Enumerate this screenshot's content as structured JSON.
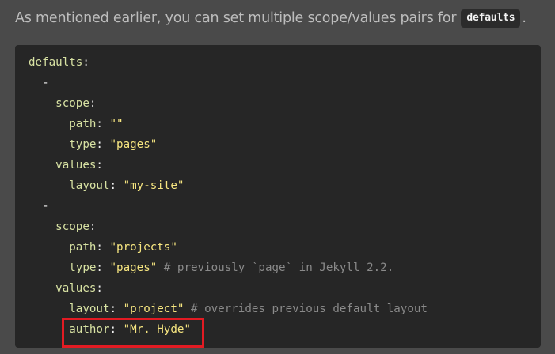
{
  "intro": {
    "text": "As mentioned earlier, you can set multiple scope/values pairs for",
    "code": "defaults",
    "trail": "."
  },
  "code_lines": [
    {
      "indent": "",
      "parts": [
        {
          "t": "defaults",
          "c": "k"
        },
        {
          "t": ":",
          "c": "p"
        }
      ]
    },
    {
      "indent": "  ",
      "parts": [
        {
          "t": "-",
          "c": "p"
        }
      ]
    },
    {
      "indent": "    ",
      "parts": [
        {
          "t": "scope",
          "c": "k"
        },
        {
          "t": ":",
          "c": "p"
        }
      ]
    },
    {
      "indent": "      ",
      "parts": [
        {
          "t": "path",
          "c": "k"
        },
        {
          "t": ": ",
          "c": "p"
        },
        {
          "t": "\"\"",
          "c": "s"
        }
      ]
    },
    {
      "indent": "      ",
      "parts": [
        {
          "t": "type",
          "c": "k"
        },
        {
          "t": ": ",
          "c": "p"
        },
        {
          "t": "\"pages\"",
          "c": "s"
        }
      ]
    },
    {
      "indent": "    ",
      "parts": [
        {
          "t": "values",
          "c": "k"
        },
        {
          "t": ":",
          "c": "p"
        }
      ]
    },
    {
      "indent": "      ",
      "parts": [
        {
          "t": "layout",
          "c": "k"
        },
        {
          "t": ": ",
          "c": "p"
        },
        {
          "t": "\"my-site\"",
          "c": "s"
        }
      ]
    },
    {
      "indent": "  ",
      "parts": [
        {
          "t": "-",
          "c": "p"
        }
      ]
    },
    {
      "indent": "    ",
      "parts": [
        {
          "t": "scope",
          "c": "k"
        },
        {
          "t": ":",
          "c": "p"
        }
      ]
    },
    {
      "indent": "      ",
      "parts": [
        {
          "t": "path",
          "c": "k"
        },
        {
          "t": ": ",
          "c": "p"
        },
        {
          "t": "\"projects\"",
          "c": "s"
        }
      ]
    },
    {
      "indent": "      ",
      "parts": [
        {
          "t": "type",
          "c": "k"
        },
        {
          "t": ": ",
          "c": "p"
        },
        {
          "t": "\"pages\"",
          "c": "s"
        },
        {
          "t": " # previously `page` in Jekyll 2.2.",
          "c": "c"
        }
      ]
    },
    {
      "indent": "    ",
      "parts": [
        {
          "t": "values",
          "c": "k"
        },
        {
          "t": ":",
          "c": "p"
        }
      ]
    },
    {
      "indent": "      ",
      "parts": [
        {
          "t": "layout",
          "c": "k"
        },
        {
          "t": ": ",
          "c": "p"
        },
        {
          "t": "\"project\"",
          "c": "s"
        },
        {
          "t": " # overrides previous default layout",
          "c": "c"
        }
      ]
    },
    {
      "indent": "      ",
      "parts": [
        {
          "t": "author",
          "c": "k"
        },
        {
          "t": ": ",
          "c": "p"
        },
        {
          "t": "\"Mr. Hyde\"",
          "c": "s"
        }
      ]
    }
  ],
  "colors": {
    "page_background": "#4a4a4a",
    "code_background": "#262626",
    "key": "#d8e2a3",
    "string": "#f7e680",
    "comment": "#8a8a8a",
    "highlight_border": "#e21b23"
  }
}
